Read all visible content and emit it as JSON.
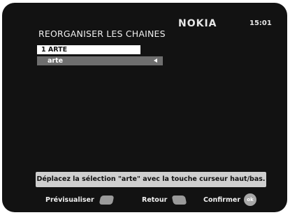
{
  "header": {
    "title": "REORGANISER LES CHAINES",
    "brand": "NOKIA",
    "time": "15:01"
  },
  "list": {
    "selected_item": "1 ARTE",
    "moving_item": "arte",
    "moving_item_icon": "arrow-left-icon"
  },
  "help_text": "Déplacez la sélection \"arte\" avec la touche curseur haut/bas.",
  "footer": {
    "preview_label": "Prévisualiser",
    "back_label": "Retour",
    "confirm_label": "Confirmer",
    "ok_key_label": "ok"
  },
  "colors": {
    "screen_bg": "#121212",
    "highlight": "#ffffff",
    "edit_row": "#6e6e6e",
    "help_bar": "#cfcfcf"
  }
}
